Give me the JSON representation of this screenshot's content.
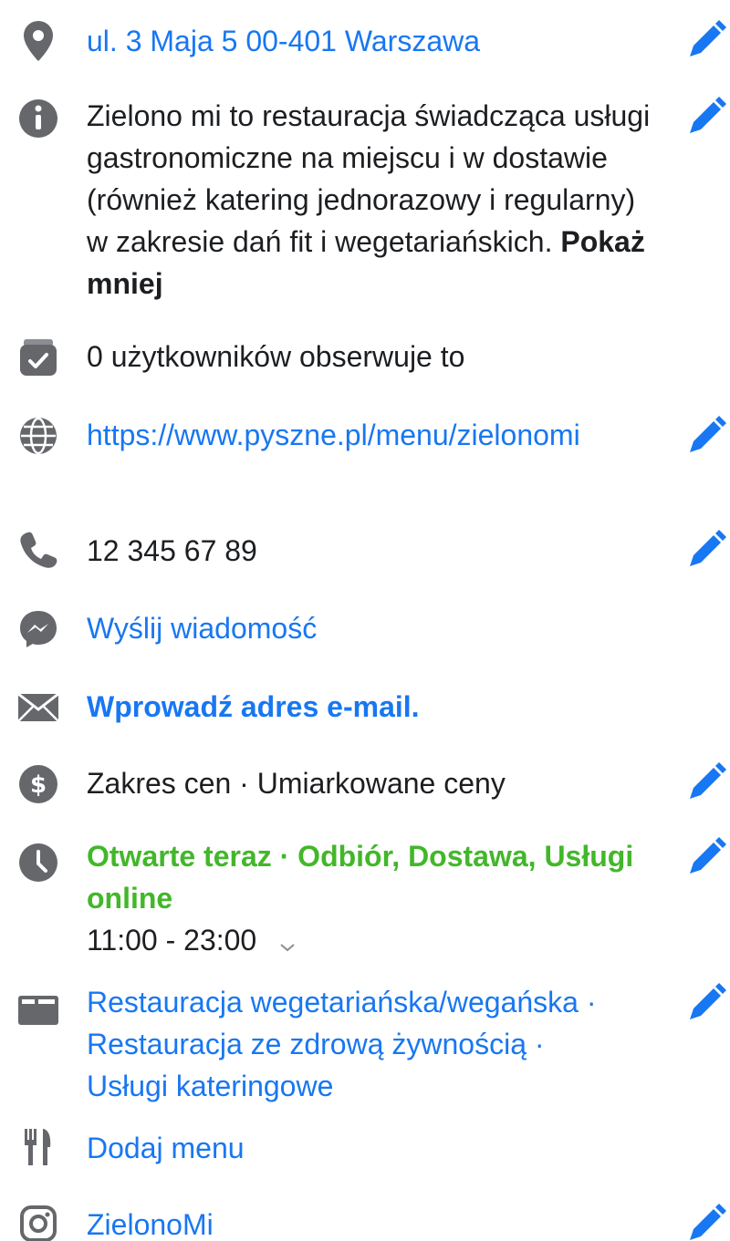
{
  "colors": {
    "link": "#1877f2",
    "open_status": "#42b72a",
    "icon_gray": "#65676b",
    "text": "#1c1e21"
  },
  "address": {
    "icon": "location-pin-icon",
    "text": "ul. 3 Maja 5 00-401 Warszawa"
  },
  "about": {
    "icon": "info-icon",
    "text": "Zielono mi to restauracja świadcząca usługi gastronomiczne na miejscu i w dostawie (również katering jednorazowy i regularny) w zakresie dań fit i wegetariańskich.",
    "toggle": "Pokaż mniej"
  },
  "followers": {
    "icon": "followers-check-icon",
    "text": "0 użytkowników obserwuje to"
  },
  "website": {
    "icon": "globe-icon",
    "text": "https://www.pyszne.pl/menu/zielonomi"
  },
  "phone": {
    "icon": "phone-icon",
    "text": "12 345 67 89"
  },
  "messenger": {
    "icon": "messenger-icon",
    "text": "Wyślij wiadomość"
  },
  "email": {
    "icon": "envelope-icon",
    "text": "Wprowadź adres e-mail."
  },
  "price": {
    "icon": "dollar-icon",
    "text": "Zakres cen · Umiarkowane ceny"
  },
  "hours": {
    "icon": "clock-icon",
    "status": "Otwarte teraz · Odbiór, Dostawa, Usługi online",
    "time": "11:00 - 23:00"
  },
  "categories": {
    "icon": "category-folder-icon",
    "items": [
      "Restauracja wegetariańska/wegańska ·",
      "Restauracja ze zdrową żywnością ·",
      "Usługi kateringowe"
    ]
  },
  "menu": {
    "icon": "fork-knife-icon",
    "text": "Dodaj menu"
  },
  "instagram": {
    "icon": "instagram-icon",
    "text": "ZielonoMi"
  }
}
